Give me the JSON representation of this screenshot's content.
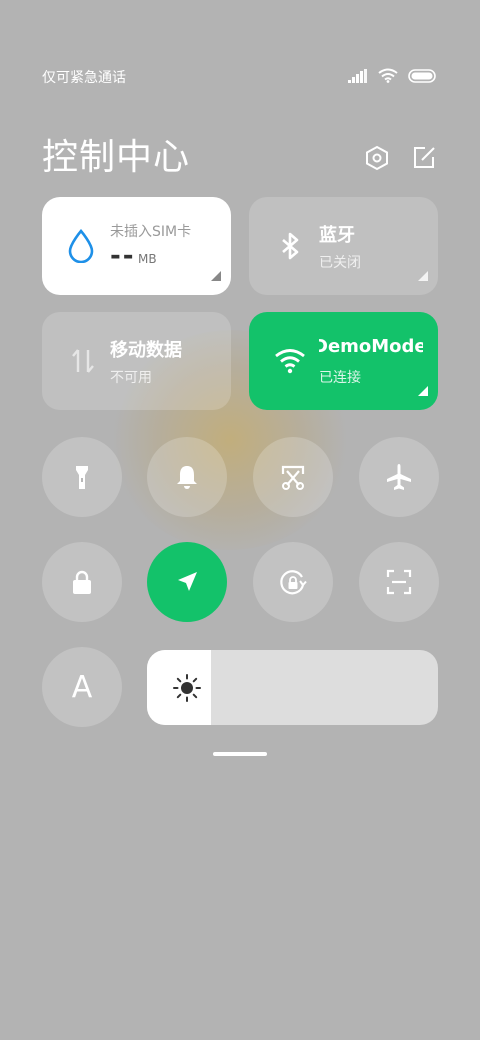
{
  "status_bar": {
    "carrier_text": "仅可紧急通话",
    "icons": [
      "signal-icon",
      "wifi-icon",
      "battery-icon"
    ]
  },
  "header": {
    "title": "控制中心",
    "settings_icon": "settings-hexagon-icon",
    "edit_icon": "edit-icon"
  },
  "tiles": {
    "data_usage": {
      "label": "未插入SIM卡",
      "value": "--",
      "unit": "MB",
      "icon": "water-drop-icon",
      "accent": "#1e90e8"
    },
    "bluetooth": {
      "name": "蓝牙",
      "status": "已关闭",
      "icon": "bluetooth-icon"
    },
    "mobile_data": {
      "name": "移动数据",
      "status": "不可用",
      "icon": "data-arrows-icon"
    },
    "wifi": {
      "name": "DemoMode",
      "status": "已连接",
      "icon": "wifi-icon",
      "color": "#13c26a"
    }
  },
  "toggles_row1": [
    "flashlight-icon",
    "bell-icon",
    "screenshot-icon",
    "airplane-icon"
  ],
  "toggles_row2": [
    "lock-icon",
    "location-icon",
    "rotation-lock-icon",
    "scan-icon"
  ],
  "font_button": {
    "label": "A"
  },
  "brightness": {
    "level": 0.22,
    "icon": "sun-icon"
  },
  "colors": {
    "background": "#b3b3b3",
    "accent_green": "#13c26a",
    "drop_blue": "#1e90e8"
  }
}
